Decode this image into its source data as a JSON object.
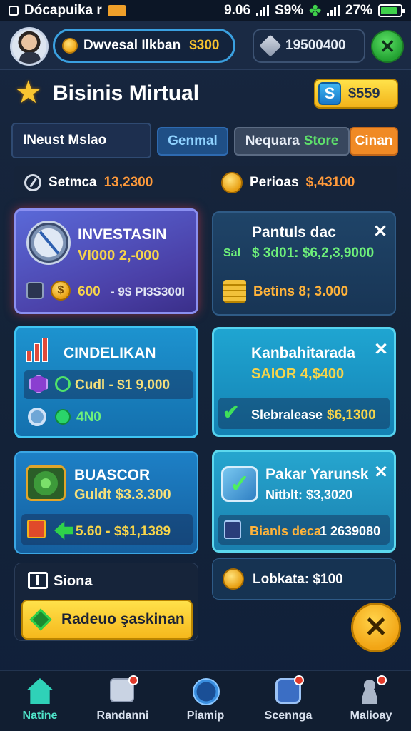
{
  "status_bar": {
    "left_text": "Dócapuika r",
    "time": "9.06",
    "signal_text": "S9%",
    "battery_text": "27%"
  },
  "header": {
    "deal_label": "Dwvesal Ilkban",
    "deal_amount": "$300",
    "gems_value": "19500400"
  },
  "title_row": {
    "title": "Bisinis Mirtual",
    "cash_value": "$559",
    "cash_icon_letter": "S"
  },
  "tabs": [
    {
      "label": "INeust Mslao"
    },
    {
      "label": "Genmal"
    },
    {
      "label": "Nequara",
      "label_green": "Store"
    },
    {
      "label": "Cinan"
    }
  ],
  "stats": [
    {
      "label": "Setmca",
      "value": "13,2300"
    },
    {
      "label": "Perioas",
      "value": "$,43100"
    }
  ],
  "cards": {
    "investasin": {
      "title": "INVESTASIN",
      "value": "VI000 2,-000",
      "row_amount": "600",
      "row_detail": "- 9$ PI3S300I"
    },
    "pantuls": {
      "title": "Pantuls dac",
      "sub_prefix": "Sal",
      "sub_value": "$ 3d01: $6,2,3,9000",
      "row_text": "Betins 8; 3.000"
    },
    "cindelikan": {
      "title": "CINDELIKAN",
      "row1": "Cudl - $1 9,000",
      "row2": "4N0"
    },
    "kanbahitarada": {
      "title": "Kanbahitarada",
      "value": "SAIOR 4,$400",
      "row_text": "Slebralease",
      "row_value": "$6,1300"
    },
    "buascor": {
      "title": "BUASCOR",
      "value": "Guldt $3.3.300",
      "row_text": "5.60 - $$1,1389"
    },
    "pakar": {
      "title": "Pakar Yarunsk",
      "value": "Nitblt: $3,3020",
      "row_text": "Bianls deca",
      "row_value": "1 2639080"
    },
    "siona": {
      "title": "Siona",
      "button_label": "Radeuo şaskinan"
    },
    "lobkata": {
      "text": "Lobkata: $100"
    }
  },
  "bottom_nav": [
    {
      "label": "Natine",
      "icon": "home-icon"
    },
    {
      "label": "Randanni",
      "icon": "dice-icon"
    },
    {
      "label": "Piamip",
      "icon": "compass-icon"
    },
    {
      "label": "Scennga",
      "icon": "gear-icon"
    },
    {
      "label": "Malioay",
      "icon": "profile-icon"
    }
  ],
  "colors": {
    "background": "#142338",
    "accent_yellow": "#f7c32e",
    "accent_green": "#3fd14b",
    "accent_orange": "#f08a25",
    "nav_active": "#4fe3c9"
  }
}
